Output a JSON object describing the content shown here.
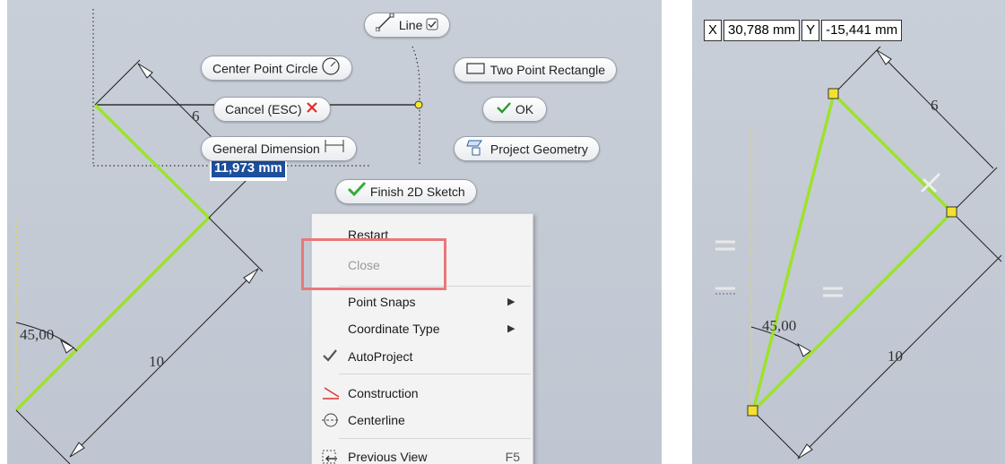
{
  "marking_menu": {
    "line": "Line",
    "center_point_circle": "Center Point Circle",
    "two_point_rectangle": "Two Point Rectangle",
    "cancel": "Cancel (ESC)",
    "ok": "OK",
    "general_dimension": "General Dimension",
    "project_geometry": "Project Geometry",
    "finish_2d_sketch": "Finish 2D Sketch"
  },
  "dimension_input": "11,973 mm",
  "context_menu": {
    "restart": "Restart",
    "close": "Close",
    "point_snaps": "Point Snaps",
    "coordinate_type": "Coordinate Type",
    "autoproject": "AutoProject",
    "construction": "Construction",
    "centerline": "Centerline",
    "previous_view": "Previous View",
    "previous_view_shortcut": "F5"
  },
  "left_sketch": {
    "dim_6": "6",
    "dim_10": "10",
    "angle": "45,00"
  },
  "right_sketch": {
    "x_label": "X",
    "x_value": "30,788 mm",
    "y_label": "Y",
    "y_value": "-15,441 mm",
    "dim_6": "6",
    "dim_10": "10",
    "angle": "45,00"
  },
  "colors": {
    "sketch_line": "#9de22d",
    "highlight_box": "#e8787a",
    "selection": "#1c4f9c"
  },
  "icons": [
    "line-icon",
    "checkbox-icon",
    "circle-icon",
    "rectangle-icon",
    "cancel-x-icon",
    "ok-check-icon",
    "dimension-icon",
    "project-geometry-icon",
    "finish-sketch-check-icon",
    "autoproject-check-icon",
    "construction-icon",
    "centerline-icon",
    "previous-view-icon",
    "submenu-arrow-icon"
  ]
}
